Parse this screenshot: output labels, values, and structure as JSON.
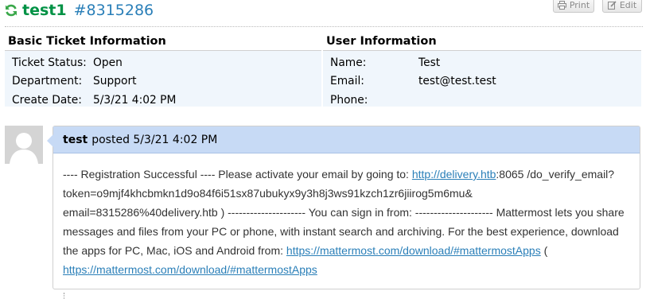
{
  "ticket": {
    "name": "test1",
    "number": "#8315286"
  },
  "header_buttons": {
    "print_label": "Print",
    "edit_label": "Edit"
  },
  "basic_info": {
    "title": "Basic Ticket Information",
    "rows": [
      {
        "label": "Ticket Status:",
        "value": "Open"
      },
      {
        "label": "Department:",
        "value": "Support"
      },
      {
        "label": "Create Date:",
        "value": "5/3/21 4:02 PM"
      }
    ]
  },
  "user_info": {
    "title": "User Information",
    "rows": [
      {
        "label": "Name:",
        "value": "Test"
      },
      {
        "label": "Email:",
        "value": "test@test.test"
      },
      {
        "label": "Phone:",
        "value": ""
      }
    ]
  },
  "thread": {
    "poster": "test",
    "posted_text": "posted 5/3/21 4:02 PM",
    "body": {
      "text_1": "---- Registration Successful ---- Please activate your email by going to: ",
      "link_1": "http://delivery.htb",
      "text_2": ":8065 /do_verify_email?token=o9mjf4khcbmkn1d9o84f6i51sx87ubukyx9y3h8j3ws91kzch1zr6jiirog5m6mu& email=8315286%40delivery.htb ) --------------------- You can sign in from: --------------------- Mattermost lets you share messages and files from your PC or phone, with instant search and archiving. For the best experience, download the apps for PC, Mac, iOS and Android from: ",
      "link_2": "https://mattermost.com/download/#mattermostApps",
      "text_3": " ( ",
      "link_3": "https://mattermost.com/download/#mattermostApps"
    }
  },
  "colors": {
    "ticket_name": "#009245",
    "ticket_number": "#2a7fb8",
    "info_bg": "#f0f6fc",
    "post_header_bg": "#c7daf5",
    "link": "#2a7fb8"
  },
  "icons": [
    "refresh-icon",
    "print-icon",
    "edit-icon",
    "avatar-placeholder"
  ]
}
